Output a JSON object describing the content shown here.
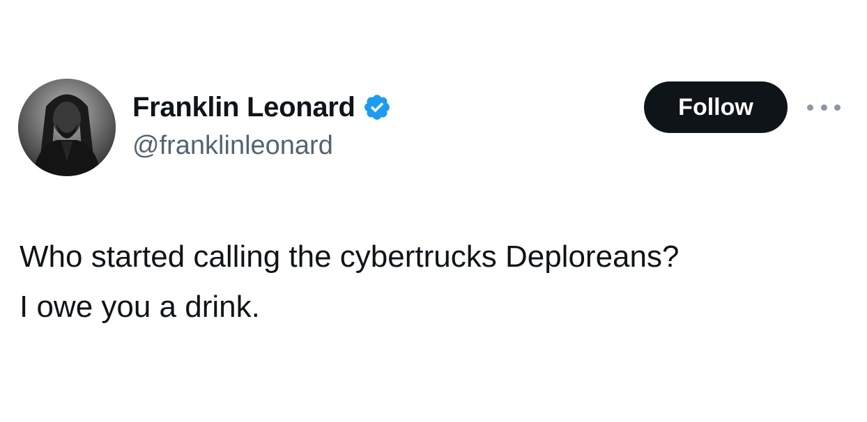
{
  "author": {
    "display_name": "Franklin Leonard",
    "handle": "@franklinleonard",
    "verified": true,
    "avatar_icon": "profile-photo",
    "verified_icon": "verified-badge-icon"
  },
  "actions": {
    "follow_label": "Follow",
    "more_icon": "more-options-icon"
  },
  "tweet": {
    "lines": [
      "Who started calling the cybertrucks Deploreans?",
      "I owe you a drink."
    ]
  },
  "colors": {
    "verified_blue": "#1d9bf0",
    "follow_bg": "#0f1419",
    "handle_gray": "#536471",
    "text": "#0f1419"
  }
}
